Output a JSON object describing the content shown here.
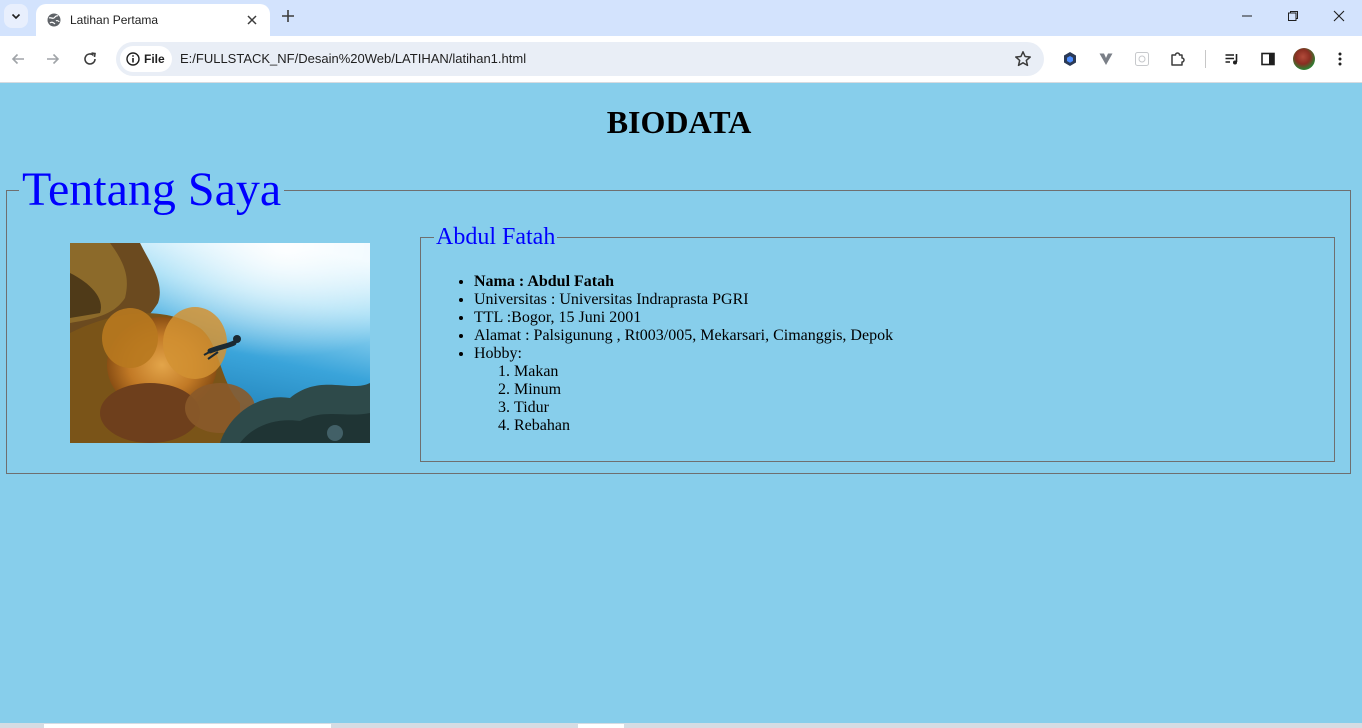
{
  "browser": {
    "tab_title": "Latihan Pertama",
    "site_chip_label": "File",
    "url": "E:/FULLSTACK_NF/Desain%20Web/LATIHAN/latihan1.html",
    "icons": {
      "tab_search": "chevron-down-icon",
      "tab_favicon": "globe-icon",
      "tab_close": "close-icon",
      "new_tab": "plus-icon",
      "minimize": "minimize-icon",
      "restore": "restore-icon",
      "close_window": "close-icon",
      "back": "back-arrow-icon",
      "forward": "forward-arrow-icon",
      "reload": "reload-icon",
      "site_info": "info-icon",
      "bookmark": "star-icon",
      "extensions": [
        "hexagon-extension-icon",
        "v-extension-icon",
        "grid-extension-icon",
        "puzzle-icon"
      ],
      "media": "media-queue-icon",
      "side_panel": "side-panel-icon",
      "menu": "kebab-menu-icon"
    },
    "colors": {
      "tabstrip": "#d3e3fd",
      "toolbar": "#ffffff",
      "omnibox": "#e9eef6"
    }
  },
  "page": {
    "background": "#87ceeb",
    "heading": "BIODATA",
    "section_title": "Tentang Saya",
    "profile": {
      "name_legend": "Abdul Fatah",
      "photo": "underwater-coral-reef-diver-photo",
      "items": [
        {
          "text": "Nama : Abdul Fatah",
          "bold": true
        },
        {
          "text": "Universitas : Universitas Indraprasta PGRI"
        },
        {
          "text": "TTL :Bogor, 15 Juni 2001"
        },
        {
          "text": "Alamat : Palsigunung , Rt003/005, Mekarsari, Cimanggis, Depok"
        }
      ],
      "hobby_label": "Hobby:",
      "hobbies": [
        "Makan",
        "Minum",
        "Tidur",
        "Rebahan"
      ]
    },
    "legend_color": "#0000ff"
  }
}
